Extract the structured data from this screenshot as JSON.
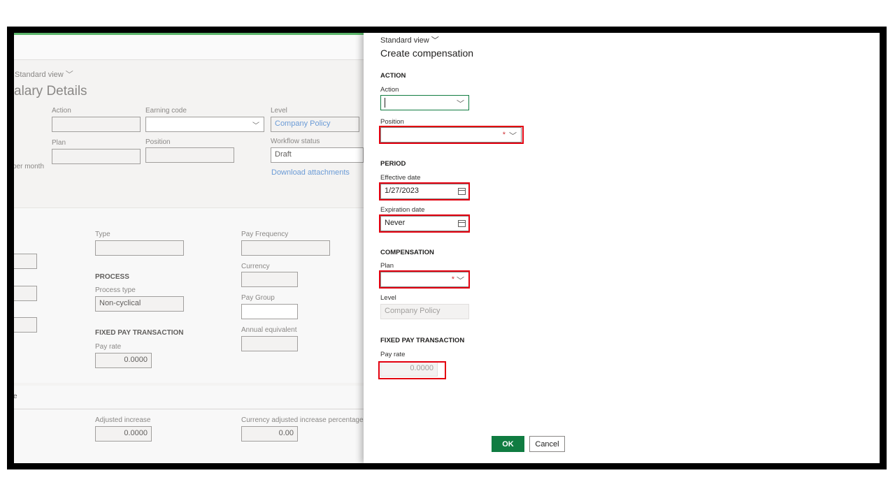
{
  "background": {
    "view_selector": "Standard view",
    "page_title": "alary Details",
    "fields": {
      "action_label": "Action",
      "earning_code_label": "Earning code",
      "level_label": "Level",
      "level_value": "Company Policy",
      "plan_label": "Plan",
      "position_label": "Position",
      "workflow_status_label": "Workflow status",
      "workflow_status_value": "Draft",
      "per_month_label": "per month",
      "download_link": "Download attachments"
    },
    "details": {
      "type_label": "Type",
      "pay_frequency_label": "Pay Frequency",
      "currency_label": "Currency",
      "process_heading": "PROCESS",
      "process_type_label": "Process type",
      "process_type_value": "Non-cyclical",
      "pay_group_label": "Pay Group",
      "fixed_pay_heading": "FIXED PAY TRANSACTION",
      "annual_equivalent_label": "Annual equivalent",
      "pay_rate_label": "Pay rate",
      "pay_rate_value": "0.0000"
    },
    "increase": {
      "section_fragment": "e",
      "adjusted_increase_label": "Adjusted increase",
      "adjusted_increase_value": "0.0000",
      "currency_adjusted_label": "Currency adjusted increase percentage",
      "currency_adjusted_value": "0.00"
    }
  },
  "panel": {
    "view_selector": "Standard view",
    "title": "Create compensation",
    "action_section": {
      "heading": "ACTION",
      "action_label": "Action",
      "action_value": "",
      "position_label": "Position",
      "position_value": ""
    },
    "period_section": {
      "heading": "PERIOD",
      "effective_date_label": "Effective date",
      "effective_date_value": "1/27/2023",
      "expiration_date_label": "Expiration date",
      "expiration_date_value": "Never"
    },
    "compensation_section": {
      "heading": "COMPENSATION",
      "plan_label": "Plan",
      "plan_value": "",
      "level_label": "Level",
      "level_value": "Company Policy"
    },
    "fixed_pay_section": {
      "heading": "FIXED PAY TRANSACTION",
      "pay_rate_label": "Pay rate",
      "pay_rate_value": "0.0000"
    },
    "required_marker": "*",
    "ok_label": "OK",
    "cancel_label": "Cancel"
  },
  "colors": {
    "accent_green": "#107c41",
    "highlight_red": "#e3000f",
    "link_blue": "#6b9bd6"
  }
}
